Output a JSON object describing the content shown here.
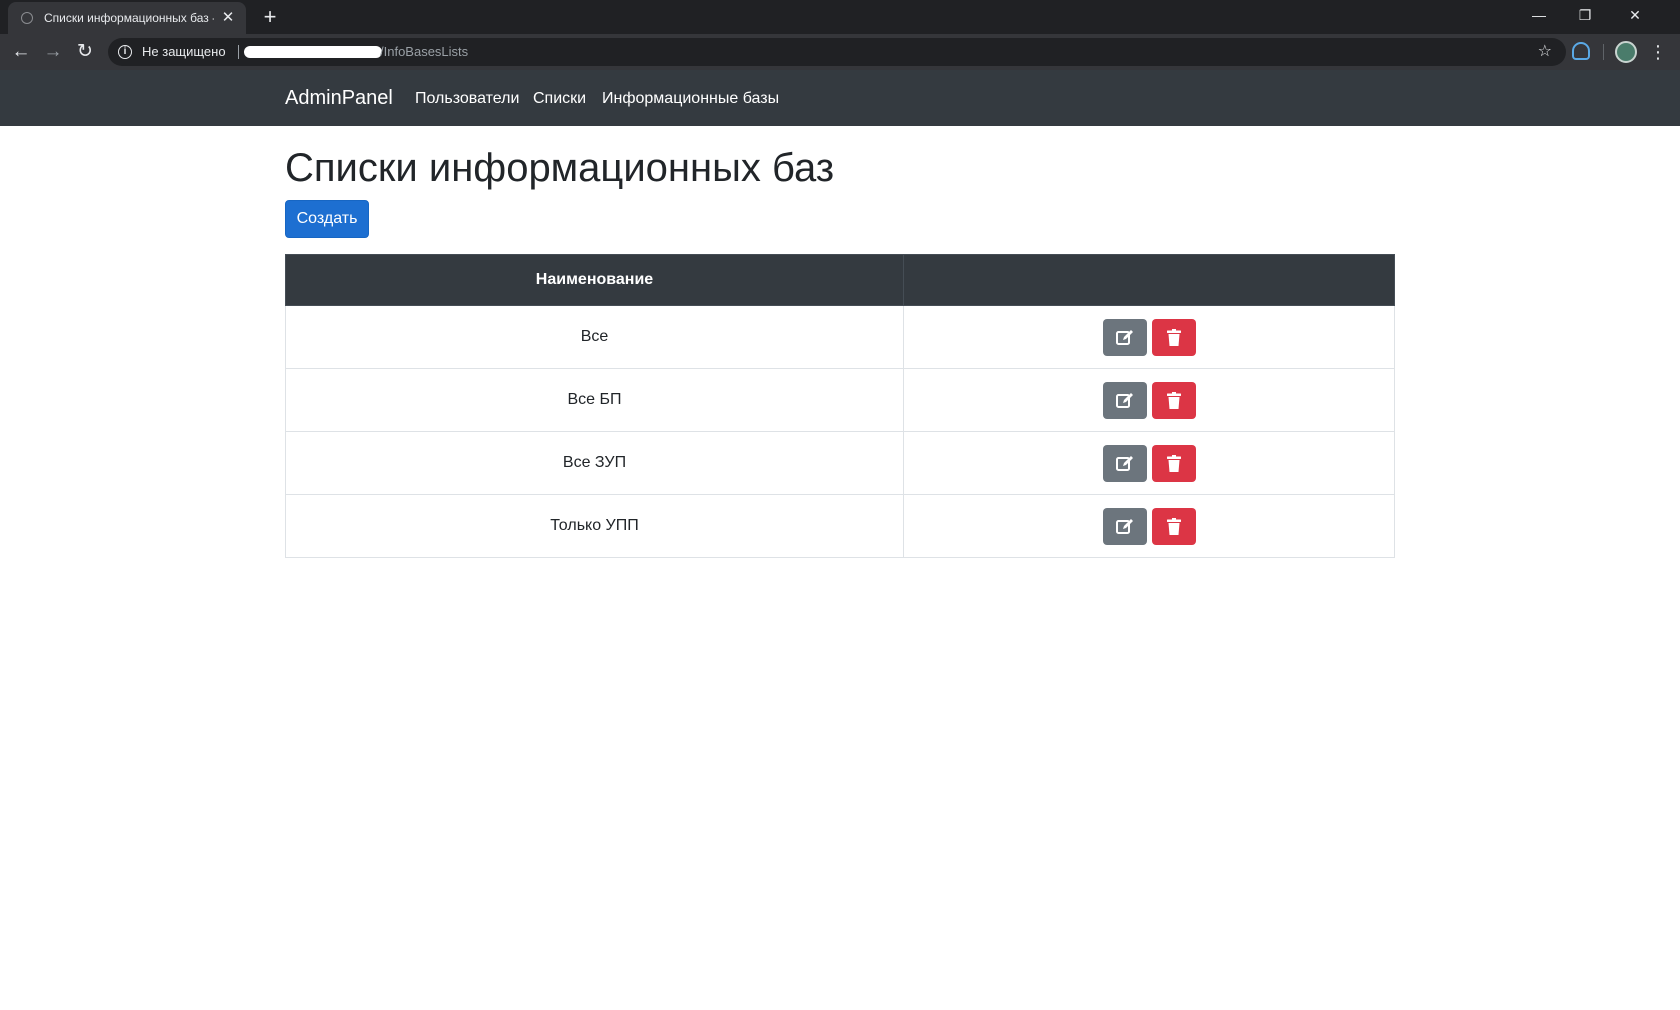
{
  "browser": {
    "tab_title": "Списки информационных баз -",
    "tab_close": "✕",
    "new_tab": "+",
    "controls": {
      "minimize": "—",
      "restore": "❐",
      "close": "✕"
    },
    "nav": {
      "back": "←",
      "forward": "→",
      "reload": "↻"
    },
    "security_label": "Не защищено",
    "url_path": "/InfoBasesLists",
    "bookmark_star": "☆",
    "menu": "⋮"
  },
  "navbar": {
    "brand": "AdminPanel",
    "links": [
      "Пользователи",
      "Списки",
      "Информационные базы"
    ]
  },
  "page": {
    "title": "Списки информационных баз",
    "create_label": "Создать"
  },
  "table": {
    "headers": [
      "Наименование",
      ""
    ],
    "rows": [
      "Все",
      "Все БП",
      "Все ЗУП",
      "Только УПП"
    ]
  },
  "icons": {
    "edit": "edit-icon",
    "delete": "trash-icon"
  },
  "colors": {
    "navbar_bg": "#343a40",
    "primary": "#1d6fd1",
    "secondary": "#6c757d",
    "danger": "#dc3545"
  }
}
